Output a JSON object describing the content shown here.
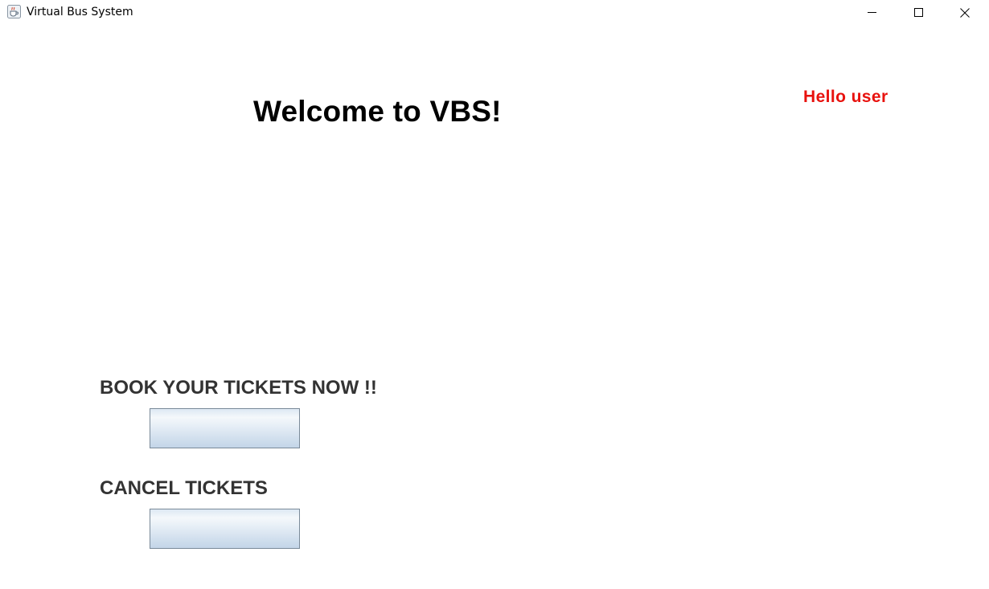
{
  "window": {
    "title": "Virtual Bus System",
    "icon": "java-coffee-cup-icon",
    "controls": {
      "minimize": "minimize-icon",
      "maximize": "maximize-icon",
      "close": "close-icon"
    }
  },
  "main": {
    "welcome_heading": "Welcome to VBS!",
    "greeting": "Hello user",
    "greeting_color": "#e8120e",
    "book_section_label": "BOOK YOUR TICKETS NOW !!",
    "book_button_label": "",
    "cancel_section_label": "CANCEL TICKETS",
    "cancel_button_label": ""
  }
}
